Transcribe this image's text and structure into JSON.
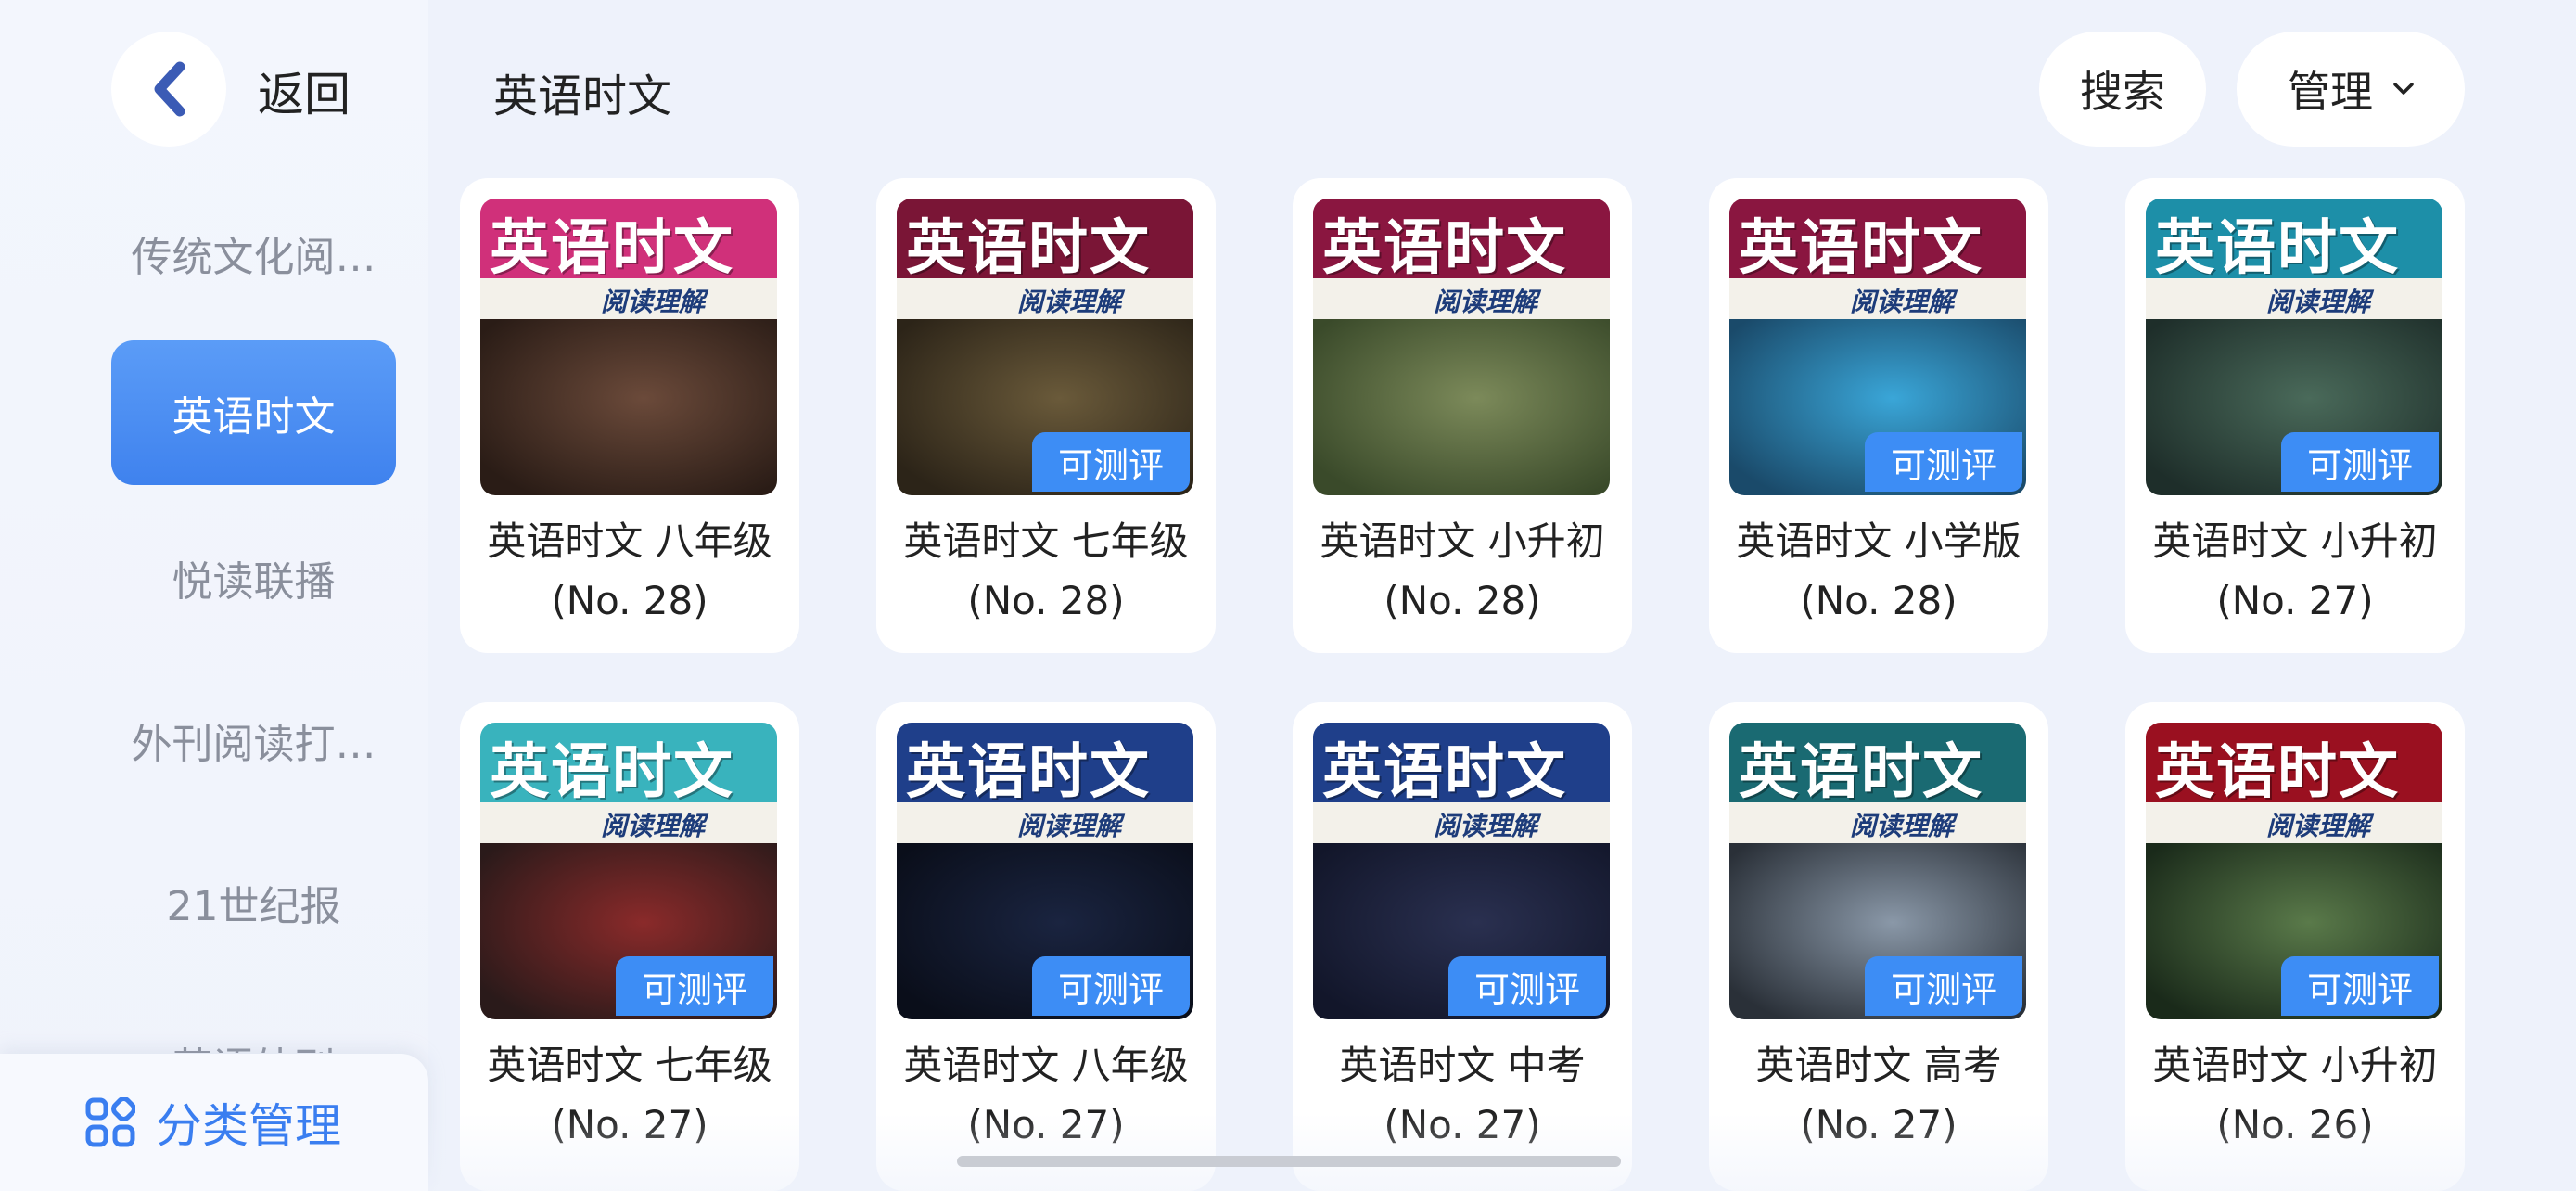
{
  "nav": {
    "back_label": "返回"
  },
  "sidebar": {
    "items": [
      {
        "label": "传统文化阅…"
      },
      {
        "label": "英语时文"
      },
      {
        "label": "悦读联播"
      },
      {
        "label": "外刊阅读打…"
      },
      {
        "label": "21世纪报"
      },
      {
        "label": "英语外刊"
      }
    ],
    "footer_label": "分类管理"
  },
  "header": {
    "title": "英语时文",
    "search_label": "搜索",
    "manage_label": "管理"
  },
  "cover_brand": "英语时文",
  "cover_subtitle": "阅读理解",
  "cards": [
    {
      "line1": "英语时文 八年级",
      "line2": "(No. 28)",
      "badge": "",
      "color": "#d0307a"
    },
    {
      "line1": "英语时文 七年级",
      "line2": "(No. 28)",
      "badge": "可测评",
      "color": "#7a1536"
    },
    {
      "line1": "英语时文 小升初",
      "line2": "(No. 28)",
      "badge": "",
      "color": "#8a1640"
    },
    {
      "line1": "英语时文 小学版",
      "line2": "(No. 28)",
      "badge": "可测评",
      "color": "#8a1640"
    },
    {
      "line1": "英语时文 小升初",
      "line2": "(No. 27)",
      "badge": "可测评",
      "color": "#1d8fa8"
    },
    {
      "line1": "英语时文 七年级",
      "line2": "(No. 27)",
      "badge": "可测评",
      "color": "#39b3bd"
    },
    {
      "line1": "英语时文 八年级",
      "line2": "(No. 27)",
      "badge": "可测评",
      "color": "#1f3f8a"
    },
    {
      "line1": "英语时文 中考",
      "line2": "(No. 27)",
      "badge": "可测评",
      "color": "#1f3f8a"
    },
    {
      "line1": "英语时文 高考",
      "line2": "(No. 27)",
      "badge": "可测评",
      "color": "#1a6a72"
    },
    {
      "line1": "英语时文 小升初",
      "line2": "(No. 26)",
      "badge": "可测评",
      "color": "#9a1020"
    }
  ],
  "colors": {
    "accent": "#3d8df5",
    "active_bg": "#4a8ff2",
    "page_bg": "#eef2fb"
  }
}
